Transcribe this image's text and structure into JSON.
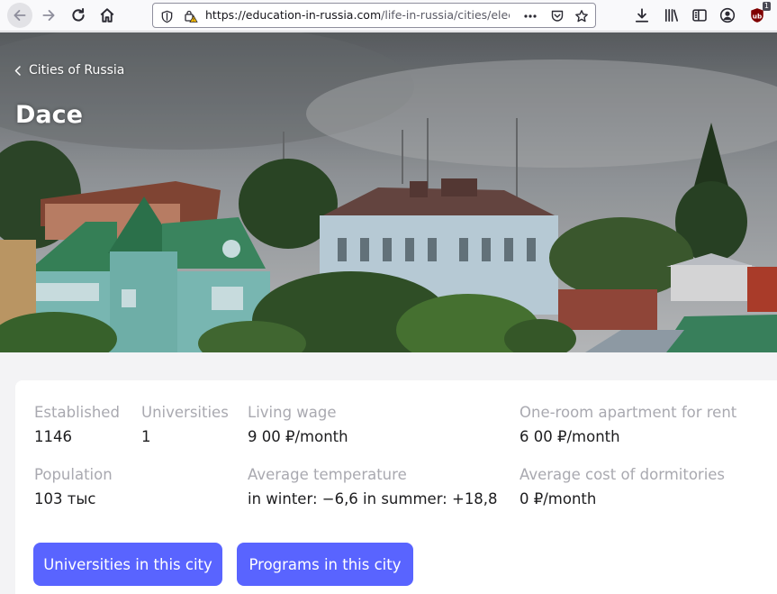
{
  "browser": {
    "url_main": "https://education-in-russia.com",
    "url_path": "/life-in-russia/cities/elec",
    "extension_badge": "1"
  },
  "hero": {
    "breadcrumb": "Cities of Russia",
    "title": "Dace"
  },
  "facts": {
    "established": {
      "label": "Established",
      "value": "1146"
    },
    "universities": {
      "label": "Universities",
      "value": "1"
    },
    "living_wage": {
      "label": "Living wage",
      "value": "9 00 ₽/month"
    },
    "rent": {
      "label": "One-room apartment for rent",
      "value": "6 00 ₽/month"
    },
    "population": {
      "label": "Population",
      "value": "103 тыс"
    },
    "temperature": {
      "label": "Average temperature",
      "value": "in winter: −6,6 in summer: +18,8"
    },
    "dormitories": {
      "label": "Average cost of dormitories",
      "value": "0 ₽/month"
    }
  },
  "actions": {
    "universities_button": "Universities in this city",
    "programs_button": "Programs in this city"
  },
  "colors": {
    "accent": "#5964ff",
    "label_gray": "#a9a9b0",
    "page_bg": "#f3f3f5"
  }
}
